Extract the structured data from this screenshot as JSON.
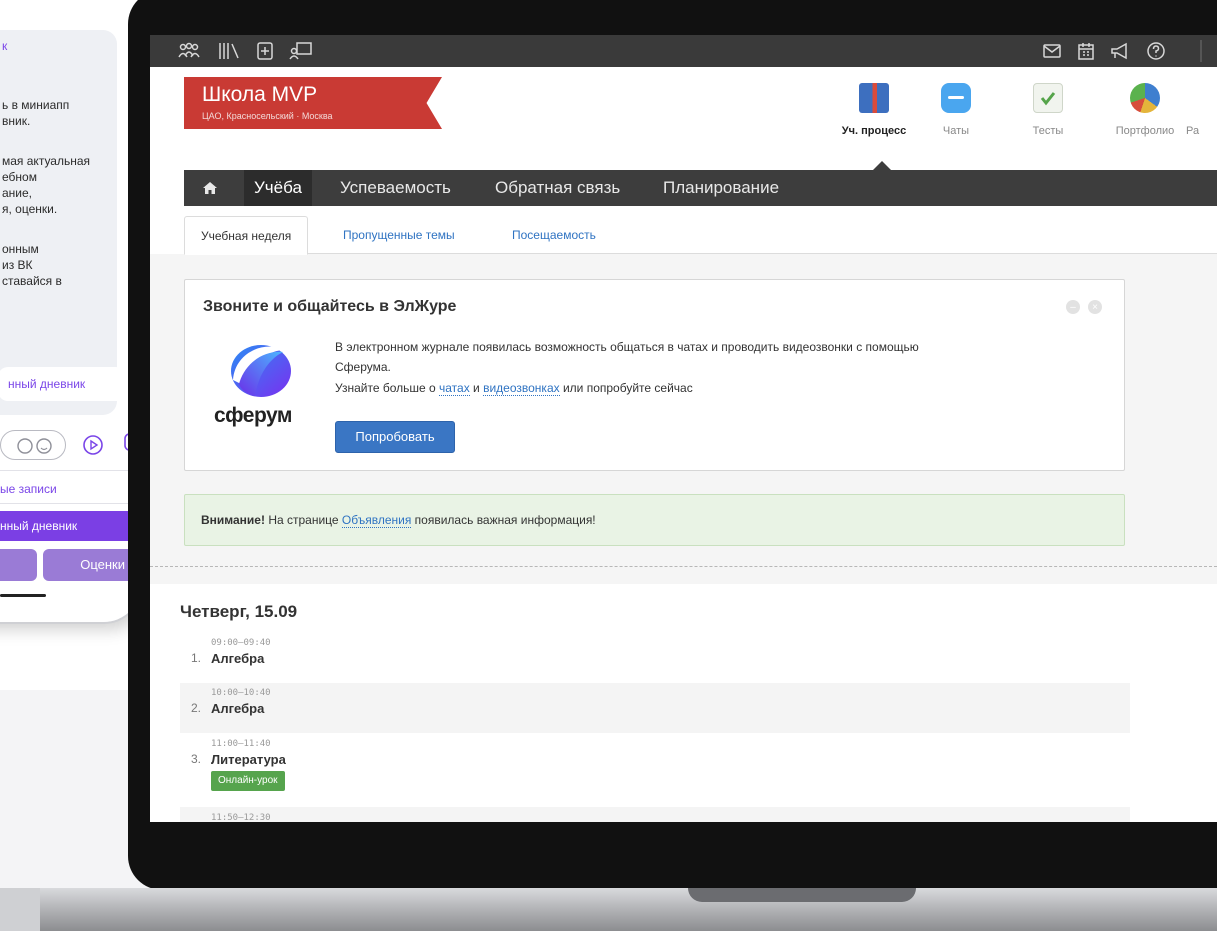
{
  "phone": {
    "bubble_lines": [
      "к",
      "ь в миниапп",
      "вник.",
      "мая актуальная",
      "ебном",
      "ание,",
      "я, оценки.",
      "онным",
      " из ВК",
      "ставайся в"
    ],
    "bubble_link": "нный дневник",
    "button_records": "ые записи",
    "button_diary": "нный дневник",
    "button_grades": "Оценки"
  },
  "school": {
    "name": "Школа MVP",
    "location": "ЦАО, Красносельский · Москва"
  },
  "modules": [
    {
      "label": "Уч. процесс",
      "active": true
    },
    {
      "label": "Чаты",
      "active": false
    },
    {
      "label": "Тесты",
      "active": false
    },
    {
      "label": "Портфолио",
      "active": false
    },
    {
      "label": "Ра",
      "active": false
    }
  ],
  "main_nav": {
    "items": [
      "Учёба",
      "Успеваемость",
      "Обратная связь",
      "Планирование"
    ],
    "active": "Учёба"
  },
  "sub_tabs": {
    "items": [
      "Учебная неделя",
      "Пропущенные темы",
      "Посещаемость"
    ],
    "active": "Учебная неделя"
  },
  "sferum_card": {
    "title": "Звоните и общайтесь в ЭлЖуре",
    "line1": "В электронном журнале появилась возможность общаться в чатах и проводить видеозвонки с помощью",
    "line2": "Сферума.",
    "line3_prefix": "Узнайте больше о ",
    "link_chats": "чатах",
    "line3_and": " и ",
    "link_video": "видеозвонках",
    "line3_suffix": " или попробуйте сейчас",
    "try_button": "Попробовать",
    "logo_word": "сферум"
  },
  "notice": {
    "bold": "Внимание!",
    "prefix": " На странице ",
    "link": "Объявления",
    "suffix": " появилась важная информация!"
  },
  "schedule": {
    "day": "Четверг, 15.09",
    "lessons": [
      {
        "num": "1.",
        "time": "09:00–09:40",
        "name": "Алгебра"
      },
      {
        "num": "2.",
        "time": "10:00–10:40",
        "name": "Алгебра"
      },
      {
        "num": "3.",
        "time": "11:00–11:40",
        "name": "Литература",
        "badge": "Онлайн-урок"
      },
      {
        "num": "",
        "time": "11:50–12:30",
        "name": ""
      }
    ]
  }
}
